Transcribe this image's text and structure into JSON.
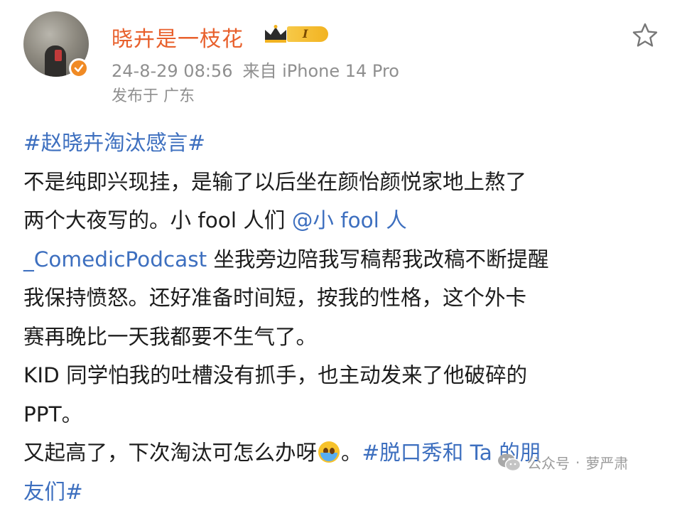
{
  "post": {
    "author": {
      "name": "晓卉是一枝花",
      "level_badge": "I"
    },
    "meta": {
      "time": "24-8-29 08:56",
      "source": "来自 iPhone 14 Pro",
      "location": "发布于 广东"
    },
    "body": {
      "line1_topic": "#赵晓卉淘汰感言#",
      "line2": "不是纯即兴现挂，是输了以后坐在颜怡颜悦家地上熬了",
      "line3_text": "两个大夜写的。小 fool 人们 ",
      "line3_mention": "@小 fool 人",
      "line4_mention": "_ComedicPodcast",
      "line4_text": " 坐我旁边陪我写稿帮我改稿不断提醒",
      "line5": "我保持愤怒。还好准备时间短，按我的性格，这个外卡",
      "line6": "赛再晚比一天我都要不生气了。",
      "line7": "KID 同学怕我的吐槽没有抓手，也主动发来了他破碎的",
      "line8": "PPT。",
      "line9_text_a": "又起高了，下次淘汰可怎么办呀",
      "line9_text_b": "。",
      "line9_topic": "#脱口秀和 Ta 的朋",
      "line10_topic": "友们#"
    }
  },
  "watermark": {
    "platform": "公众号",
    "separator": "·",
    "account": "萝严肃"
  },
  "colors": {
    "username": "#e8602c",
    "link": "#3d6fbf",
    "meta": "#8f8f8f"
  },
  "icons": {
    "favorite": "star-outline-icon",
    "verified": "verified-badge-icon",
    "crown": "crown-icon",
    "emoji": "crying-face-emoji",
    "wechat": "wechat-logo-icon"
  }
}
